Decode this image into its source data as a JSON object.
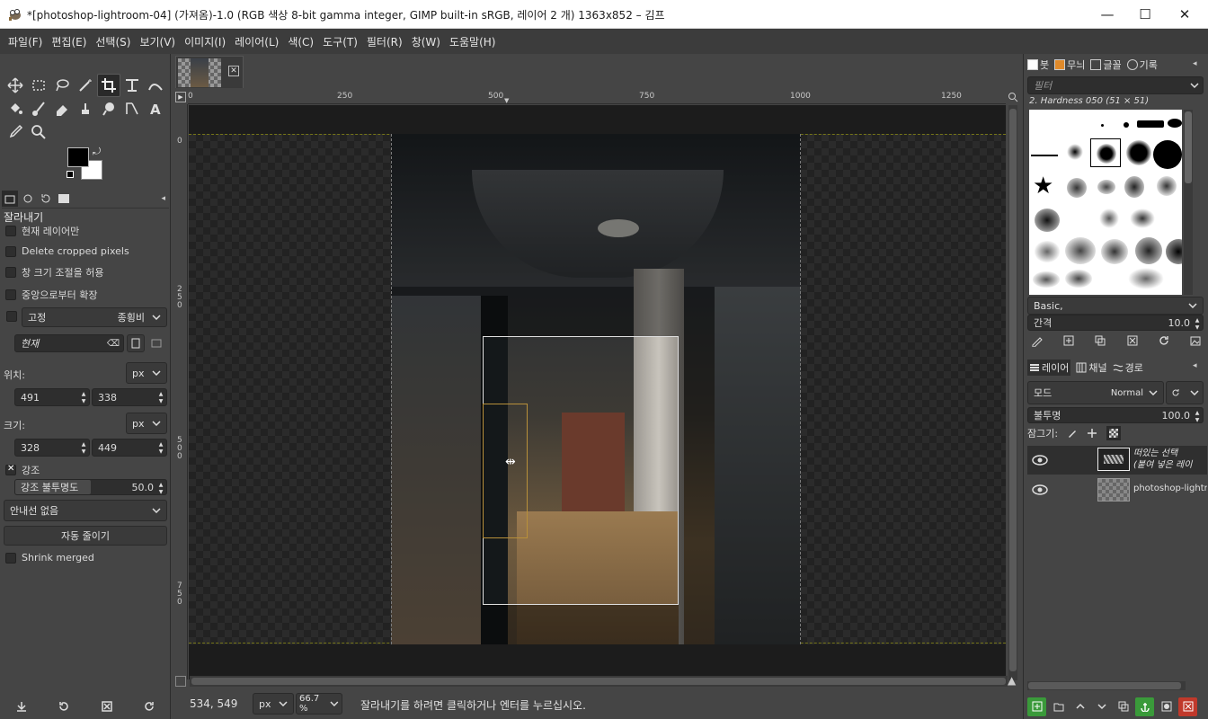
{
  "window": {
    "title": "*[photoshop-lightroom-04] (가져옴)-1.0 (RGB 색상 8-bit gamma integer, GIMP built-in sRGB, 레이어 2 개) 1363x852 – 김프",
    "minimize": "—",
    "maximize": "☐",
    "close": "✕"
  },
  "menu": [
    "파일(F)",
    "편집(E)",
    "선택(S)",
    "보기(V)",
    "이미지(I)",
    "레이어(L)",
    "색(C)",
    "도구(T)",
    "필터(R)",
    "창(W)",
    "도움말(H)"
  ],
  "tool_options": {
    "title": "잘라내기",
    "current_layer_only": "현재 레이어만",
    "delete_cropped": "Delete cropped pixels",
    "allow_growing": "창 크기 조절을 허용",
    "expand_center": "중앙으로부터 확장",
    "fixed_label": "고정",
    "fixed_value": "종횡비",
    "current_value": "현재",
    "position_label": "위치:",
    "position_unit": "px",
    "position_x": "491",
    "position_y": "338",
    "size_label": "크기:",
    "size_unit": "px",
    "size_w": "328",
    "size_h": "449",
    "highlight_label": "강조",
    "highlight_opacity_label": "강조 불투명도",
    "highlight_opacity_value": "50.0",
    "guides_value": "안내선 없음",
    "auto_shrink": "자동 줄이기",
    "shrink_merged": "Shrink merged"
  },
  "ruler": {
    "h_ticks": [
      "0",
      "250",
      "500",
      "750",
      "1000",
      "1250"
    ],
    "v_ticks": [
      "0",
      "250",
      "500",
      "750"
    ]
  },
  "statusbar": {
    "coords": "534, 549",
    "unit": "px",
    "zoom": "66.7 %",
    "message": "잘라내기를 하려면 클릭하거나 엔터를 누르십시오."
  },
  "brushes": {
    "tabs": [
      "붓",
      "무늬",
      "글꼴",
      "기록"
    ],
    "filter_placeholder": "필터",
    "selected_brush": "2. Hardness 050 (51 × 51)",
    "preset": "Basic,",
    "spacing_label": "간격",
    "spacing_value": "10.0"
  },
  "layers": {
    "tabs": [
      "레이어",
      "채널",
      "경로"
    ],
    "mode_label": "모드",
    "mode_value": "Normal",
    "opacity_label": "불투명",
    "opacity_value": "100.0",
    "lock_label": "잠그기:",
    "items": [
      {
        "name": "떠있는 선택 (붙여 넣은 레이",
        "line1": "떠있는 선택",
        "line2": "(붙여 넣은 레이"
      },
      {
        "name": "photoshop-lightroom-04"
      }
    ]
  },
  "colors": {
    "accent_green": "#3a9a3a",
    "danger_red": "#c0392b",
    "crop_border": "#e0e0e0",
    "guide_yellow": "#d6d62a"
  }
}
